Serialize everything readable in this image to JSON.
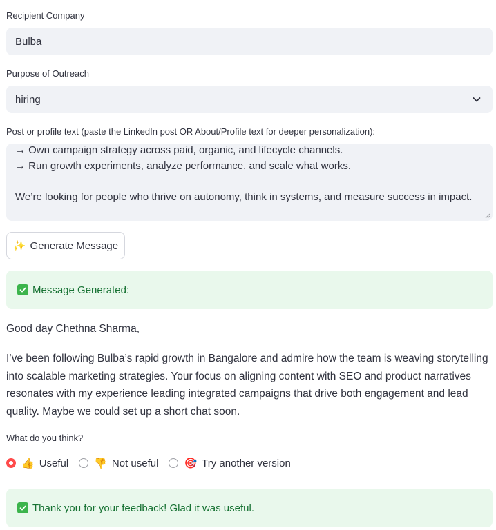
{
  "form": {
    "company_label": "Recipient Company",
    "company_value": "Bulba",
    "purpose_label": "Purpose of Outreach",
    "purpose_value": "hiring",
    "post_label": "Post or profile text (paste the LinkedIn post OR About/Profile text for deeper personalization):",
    "post_lines": [
      "→ Own campaign strategy across paid, organic, and lifecycle channels.",
      "→ Run growth experiments, analyze performance, and scale what works.",
      "",
      "We’re looking for people who thrive on autonomy, think in systems, and measure success in impact."
    ],
    "generate_icon": "✨",
    "generate_label": "Generate Message"
  },
  "result": {
    "alert_text": "Message Generated:",
    "greeting": "Good day Chethna Sharma,",
    "body": "I’ve been following Bulba’s rapid growth in Bangalore and admire how the team is weaving storytelling into scalable marketing strategies. Your focus on aligning content with SEO and product narratives resonates with my experience leading integrated campaigns that drive both engagement and lead quality. Maybe we could set up a short chat soon."
  },
  "feedback": {
    "question": "What do you think?",
    "options": [
      {
        "emoji": "👍",
        "label": "Useful",
        "selected": true
      },
      {
        "emoji": "👎",
        "label": "Not useful",
        "selected": false
      },
      {
        "emoji": "🎯",
        "label": "Try another version",
        "selected": false
      }
    ],
    "thanks": "Thank you for your feedback! Glad it was useful."
  },
  "colors": {
    "field_bg": "#f0f2f6",
    "success_bg": "#e9f8ec",
    "success_text": "#177233",
    "radio_accent": "#ff4b4b"
  }
}
